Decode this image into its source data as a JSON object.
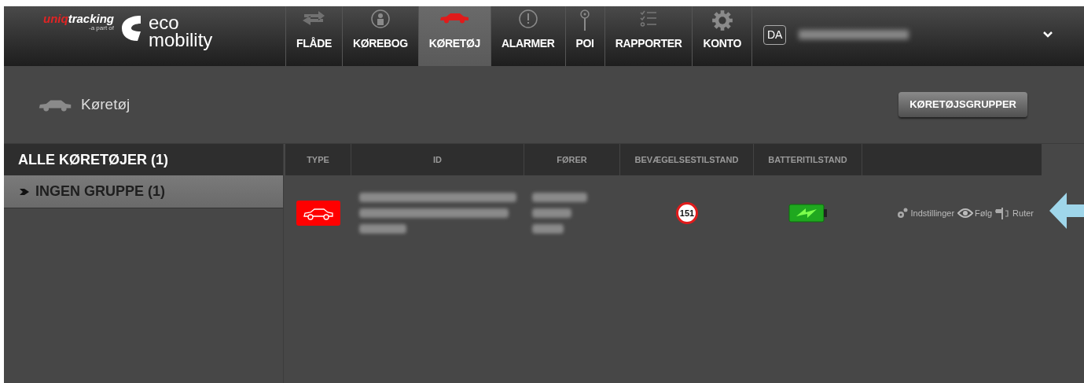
{
  "brand": {
    "name_part1": "uniq",
    "name_part2": "tracking",
    "tagline": "-a part of",
    "logo_line1": "eco",
    "logo_line2": "mobility"
  },
  "nav": [
    {
      "label": "FLÅDE",
      "kind": "arrows",
      "selected": false
    },
    {
      "label": "KØREBOG",
      "kind": "person",
      "selected": false
    },
    {
      "label": "KØRETØJ",
      "kind": "car",
      "selected": true
    },
    {
      "label": "ALARMER",
      "kind": "alert",
      "selected": false
    },
    {
      "label": "POI",
      "kind": "pin",
      "selected": false
    },
    {
      "label": "RAPPORTER",
      "kind": "list",
      "selected": false
    },
    {
      "label": "KONTO",
      "kind": "gear",
      "selected": false
    }
  ],
  "language": "DA",
  "page_title": "Køretøj",
  "groups_button": "KØRETØJSGRUPPER",
  "sidebar": {
    "title": "ALLE KØRETØJER (1)",
    "items": [
      {
        "label": "INGEN GRUPPE (1)",
        "selected": false
      }
    ]
  },
  "table": {
    "columns": [
      "TYPE",
      "ID",
      "FØRER",
      "BEVÆGELSESTILSTAND",
      "BATTERITILSTAND"
    ],
    "rows": [
      {
        "speed": "151",
        "actions": [
          {
            "kind": "settings",
            "label": "Indstillinger"
          },
          {
            "kind": "follow",
            "label": "Følg"
          },
          {
            "kind": "routes",
            "label": "Ruter"
          }
        ]
      }
    ]
  }
}
